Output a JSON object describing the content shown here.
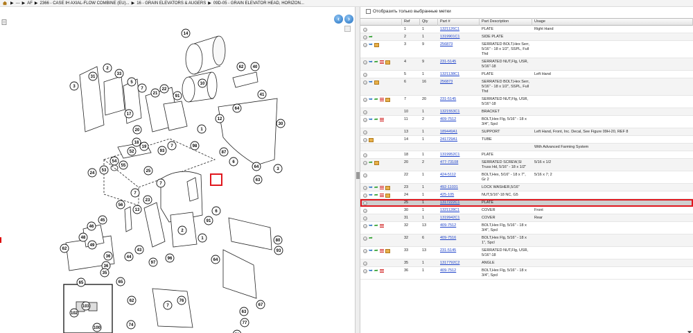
{
  "breadcrumb": {
    "items": [
      "---",
      "AF",
      "2366 - CASE IH AXIAL-FLOW COMBINE (EU)...",
      "16 - GRAIN ELEVATORS & AUGERS",
      "09D-05 - GRAIN ELEVATOR HEAD, HORIZON..."
    ],
    "separator": "▶"
  },
  "filter": {
    "label": "Отобразить только выбранные метки"
  },
  "table": {
    "headers": {
      "ref": "Ref",
      "qty": "Qty",
      "part": "Part #",
      "desc": "Part Description",
      "usage": "Usage"
    },
    "rows": [
      {
        "icons": [
          "circle"
        ],
        "ref": "1",
        "qty": "1",
        "part": "1321126C1",
        "desc": "PLATE",
        "usage": "Right Hand"
      },
      {
        "icons": [
          "circle",
          "green"
        ],
        "ref": "2",
        "qty": "1",
        "part": "1319901C1",
        "desc": "SIDE PLATE",
        "usage": ""
      },
      {
        "icons": [
          "circle",
          "blue",
          "box"
        ],
        "ref": "3",
        "qty": "9",
        "part": "256873",
        "desc": "SERRATED BOLT,Hex Serr, 5/16\" - 18 x 1/2\", SSPL, Full Thd",
        "usage": ""
      },
      {
        "icons": [
          "circle",
          "blue",
          "green",
          "list",
          "box"
        ],
        "ref": "4",
        "qty": "9",
        "part": "231-5145",
        "desc": "SERRATED NUT,Flg, USR, 5/16\"-18",
        "usage": ""
      },
      {
        "icons": [
          "circle"
        ],
        "ref": "5",
        "qty": "1",
        "part": "1321138C1",
        "desc": "PLATE",
        "usage": "Left Hand"
      },
      {
        "icons": [
          "circle",
          "blue",
          "box"
        ],
        "ref": "6",
        "qty": "16",
        "part": "256873",
        "desc": "SERRATED BOLT,Hex Serr, 5/16\" - 18 x 1/2\", SSPL, Full Thd",
        "usage": ""
      },
      {
        "icons": [
          "circle",
          "blue",
          "green",
          "list",
          "box"
        ],
        "ref": "7",
        "qty": "20",
        "part": "231-5145",
        "desc": "SERRATED NUT,Flg, USR, 5/16\"-18",
        "usage": ""
      },
      {
        "icons": [
          "circle"
        ],
        "ref": "10",
        "qty": "1",
        "part": "1321553C1",
        "desc": "BRACKET",
        "usage": ""
      },
      {
        "icons": [
          "circle",
          "blue",
          "green",
          "list"
        ],
        "ref": "11",
        "qty": "2",
        "part": "409-7512",
        "desc": "BOLT,Hex Flg, 5/16\" - 18 x 3/4\", Spcl",
        "usage": ""
      },
      {
        "icons": [
          "circle"
        ],
        "ref": "13",
        "qty": "1",
        "part": "189449A1",
        "desc": "SUPPORT",
        "usage": "Left Hand, Front, Inc. Decal, See Figure 09H-20, REF 8"
      },
      {
        "icons": [
          "circle",
          "box"
        ],
        "ref": "14",
        "qty": "1",
        "part": "241729A1",
        "desc": "TUBE",
        "usage": ""
      },
      {
        "icons": [],
        "ref": "",
        "qty": "",
        "part": "",
        "desc": "",
        "usage": "With Advanced Farming System"
      },
      {
        "icons": [
          "circle"
        ],
        "ref": "18",
        "qty": "1",
        "part": "1319952C1",
        "desc": "PLATE",
        "usage": ""
      },
      {
        "icons": [
          "circle",
          "green",
          "box"
        ],
        "ref": "20",
        "qty": "2",
        "part": "477-73108",
        "desc": "SERRATED SCREW,Sl Truss Hd, 5/16\" - 18 x 1/2\"",
        "usage": "5/16 x 1/2"
      },
      {
        "icons": [
          "circle"
        ],
        "ref": "22",
        "qty": "1",
        "part": "424-5112",
        "desc": "BOLT,Hex, 5/16\" - 18 x 7\", Gr 2",
        "usage": "5/16 x 7; 2"
      },
      {
        "icons": [
          "circle",
          "blue",
          "green",
          "list",
          "box"
        ],
        "ref": "23",
        "qty": "1",
        "part": "492-11031",
        "desc": "LOCK WASHER,5/16\"",
        "usage": ""
      },
      {
        "icons": [
          "circle",
          "blue",
          "green",
          "list",
          "box"
        ],
        "ref": "24",
        "qty": "1",
        "part": "425-105",
        "desc": "NUT,5/16\"-18 NC, G5",
        "usage": ""
      },
      {
        "icons": [
          "circle"
        ],
        "ref": "25",
        "qty": "1",
        "part": "1317222C1",
        "desc": "PLATE",
        "usage": "",
        "selected": true
      },
      {
        "icons": [
          "circle"
        ],
        "ref": "30",
        "qty": "1",
        "part": "1321128C1",
        "desc": "COVER",
        "usage": "Front"
      },
      {
        "icons": [
          "circle"
        ],
        "ref": "31",
        "qty": "1",
        "part": "1319942C1",
        "desc": "COVER",
        "usage": "Rear"
      },
      {
        "icons": [
          "circle",
          "blue",
          "green",
          "list"
        ],
        "ref": "32",
        "qty": "13",
        "part": "409-7512",
        "desc": "BOLT,Hex Flg, 5/16\" - 18 x 3/4\", Spcl",
        "usage": ""
      },
      {
        "icons": [
          "circle",
          "green"
        ],
        "ref": "32",
        "qty": "6",
        "part": "409-7516",
        "desc": "BOLT,Hex Flg, 5/16\" - 18 x 1\", Spcl",
        "usage": ""
      },
      {
        "icons": [
          "circle",
          "blue",
          "green",
          "list",
          "box"
        ],
        "ref": "33",
        "qty": "13",
        "part": "231-5145",
        "desc": "SERRATED NUT,Flg, USR, 5/16\"-18",
        "usage": ""
      },
      {
        "icons": [
          "circle"
        ],
        "ref": "35",
        "qty": "1",
        "part": "1317792C2",
        "desc": "ANGLE",
        "usage": ""
      },
      {
        "icons": [
          "circle",
          "blue",
          "green",
          "list"
        ],
        "ref": "36",
        "qty": "1",
        "part": "409-7512",
        "desc": "BOLT,Hex Flg, 5/16\" - 18 x 3/4\", Spcl",
        "usage": ""
      }
    ]
  },
  "drawing": {
    "callouts": [
      "14",
      "10",
      "62",
      "40",
      "41",
      "2",
      "33",
      "5",
      "31",
      "3",
      "7",
      "22",
      "21",
      "17",
      "20",
      "91",
      "64",
      "30",
      "12",
      "1",
      "18",
      "19",
      "93",
      "7",
      "98",
      "87",
      "6",
      "64",
      "63",
      "3",
      "52",
      "53",
      "54",
      "55",
      "24",
      "25",
      "56",
      "7",
      "23",
      "13",
      "6",
      "91",
      "7",
      "2",
      "1",
      "96",
      "97",
      "45",
      "46",
      "48",
      "49",
      "43",
      "44",
      "62",
      "36",
      "36",
      "65",
      "35",
      "65",
      "80",
      "93",
      "64",
      "67",
      "62",
      "7",
      "76",
      "63",
      "74",
      "77",
      "73",
      "84",
      "101",
      "103",
      "102",
      "100",
      "7"
    ]
  },
  "colors": {
    "link": "#1a3fc8",
    "highlight": "#e0161d",
    "selected_row": "#cfcfcf"
  }
}
